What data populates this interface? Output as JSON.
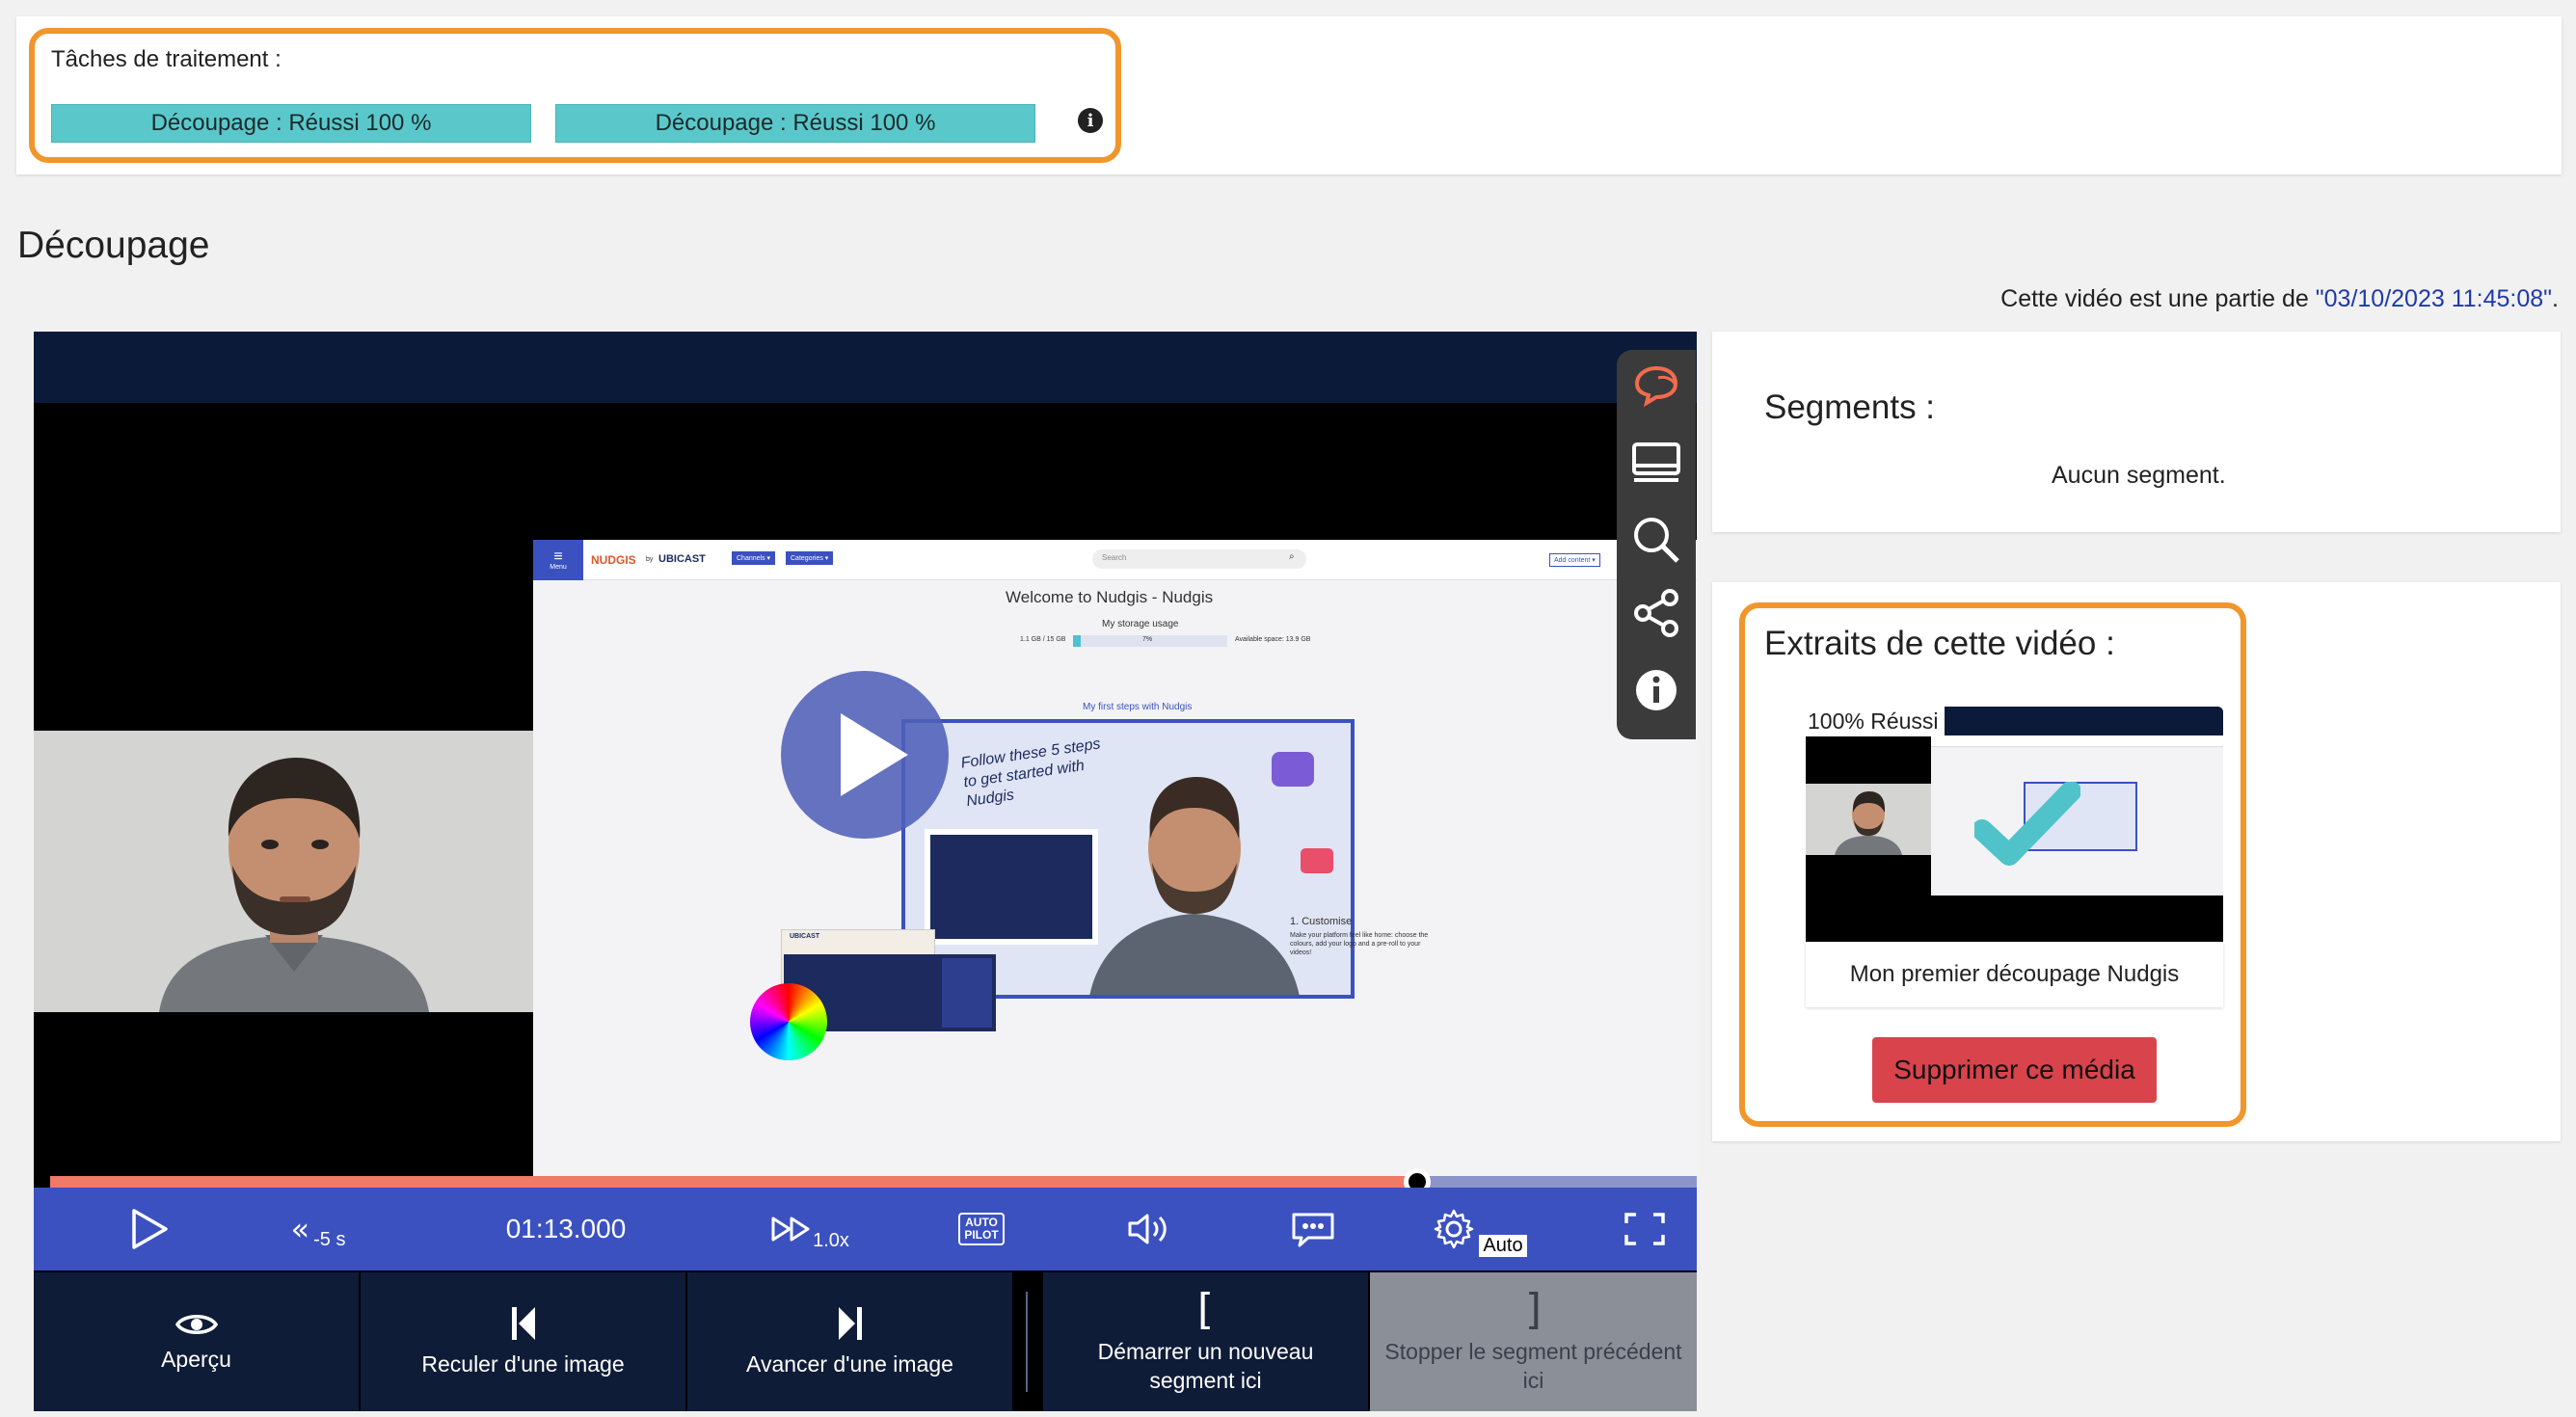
{
  "tasks": {
    "title": "Tâches de traitement :",
    "items": [
      {
        "label": "Découpage : Réussi 100 %"
      },
      {
        "label": "Découpage : Réussi 100 %"
      }
    ],
    "info_icon": "info-icon"
  },
  "section": {
    "title": "Découpage",
    "part_of_prefix": "Cette vidéo est une partie de ",
    "part_of_link": "\"03/10/2023 11:45:08\"",
    "part_of_suffix": "."
  },
  "player": {
    "screen": {
      "brand": "NUDGIS",
      "by": "by",
      "brand2": "UBICAST",
      "menu_label": "Menu",
      "channels_btn": "Channels ▾",
      "categories_btn": "Categories ▾",
      "search_placeholder": "Search",
      "add_content": "Add content ▾",
      "welcome": "Welcome to Nudgis - Nudgis",
      "storage_label": "My storage usage",
      "storage_used": "1.1 GB / 15 GB",
      "storage_pct": "7%",
      "storage_available": "Available space: 13.9 GB",
      "first_steps": "My first steps with Nudgis",
      "handwritten": "Follow these 5 steps to get started with Nudgis",
      "customise_title": "1. Customise",
      "customise_text": "Make your platform feel like home: choose the colours, add your logo and a pre-roll to your videos!",
      "mini_brand": "UBICAST"
    },
    "progress_fraction": 0.83,
    "controls": {
      "rewind_label": "-5 s",
      "time": "01:13.000",
      "speed_label": "1.0x",
      "autopilot_label": "AUTO PILOT",
      "quality_label": "Auto"
    },
    "side_icons": [
      "comments-icon",
      "layout-icon",
      "search-icon",
      "share-icon",
      "info-icon"
    ],
    "actions": [
      {
        "label": "Aperçu",
        "icon": "eye-icon"
      },
      {
        "label": "Reculer d'une image",
        "icon": "step-back-icon"
      },
      {
        "label": "Avancer d'une image",
        "icon": "step-forward-icon"
      },
      {
        "label": "Démarrer un nouveau segment ici",
        "glyph": "["
      },
      {
        "label": "Stopper le segment précédent ici",
        "glyph": "]"
      }
    ]
  },
  "segments": {
    "title": "Segments :",
    "empty": "Aucun segment."
  },
  "extracts": {
    "title": "Extraits de cette vidéo :",
    "item": {
      "status": "100% Réussi",
      "caption": "Mon premier découpage Nudgis"
    },
    "delete_label": "Supprimer ce média"
  },
  "colors": {
    "accent_orange": "#f0962c",
    "task_bar": "#5ac8cb",
    "player_controls": "#3b51c0",
    "progress": "#ef7a66",
    "delete": "#d9434c",
    "link": "#1f3aa8"
  }
}
